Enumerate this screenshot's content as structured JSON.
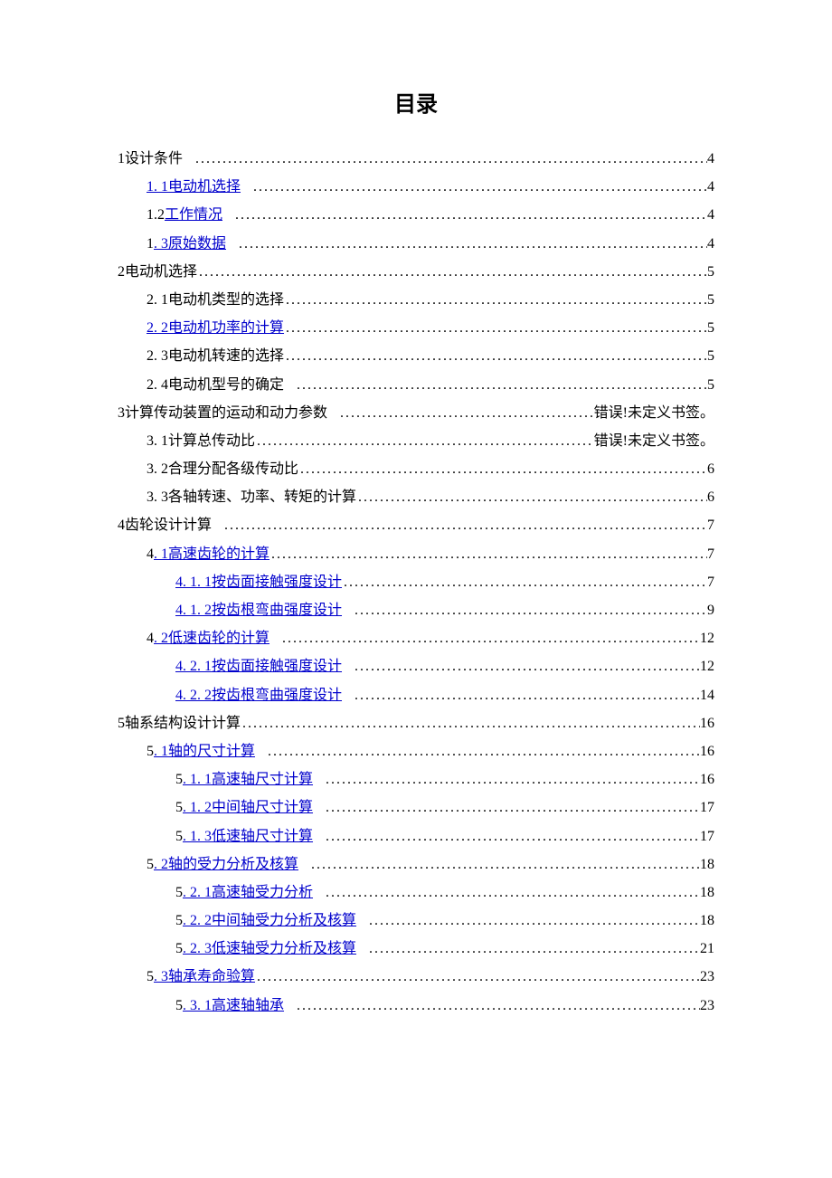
{
  "title": "目录",
  "entries": [
    {
      "level": 1,
      "label": "1设计条件",
      "page": "4",
      "linked": false,
      "leaderSpaced": true
    },
    {
      "level": 2,
      "prefix": "",
      "label": "1. 1电动机选择",
      "page": "4",
      "linked": true,
      "leaderSpaced": true
    },
    {
      "level": 2,
      "prefix": "1.2",
      "label": "工作情况",
      "page": "4",
      "linked": true,
      "leaderSpaced": true
    },
    {
      "level": 2,
      "prefix": "1",
      "label": ". 3原始数据",
      "page": "4",
      "linked": true,
      "leaderSpaced": true
    },
    {
      "level": 1,
      "label": "2电动机选择",
      "page": "5",
      "linked": false,
      "leaderSpaced": false
    },
    {
      "level": 2,
      "label": "2. 1电动机类型的选择",
      "page": "5",
      "linked": false,
      "leaderSpaced": false
    },
    {
      "level": 2,
      "prefix": "",
      "label": "2. 2电动机功率的计算",
      "page": "5",
      "linked": true,
      "leaderSpaced": false
    },
    {
      "level": 2,
      "label": "2. 3电动机转速的选择",
      "page": "5",
      "linked": false,
      "leaderSpaced": false
    },
    {
      "level": 2,
      "label": "2. 4电动机型号的确定",
      "page": "5",
      "linked": false,
      "leaderSpaced": true
    },
    {
      "level": 1,
      "label": "3计算传动装置的运动和动力参数",
      "page": "错误!未定义书签。",
      "linked": false,
      "leaderSpaced": true
    },
    {
      "level": 2,
      "label": "3. 1计算总传动比",
      "page": "错误!未定义书签。",
      "linked": false,
      "leaderSpaced": false
    },
    {
      "level": 2,
      "label": "3. 2合理分配各级传动比",
      "page": "6",
      "linked": false,
      "leaderSpaced": false
    },
    {
      "level": 2,
      "label": "3. 3各轴转速、功率、转矩的计算",
      "page": "6",
      "linked": false,
      "leaderSpaced": false
    },
    {
      "level": 1,
      "label": "4齿轮设计计算",
      "page": "7",
      "linked": false,
      "leaderSpaced": true
    },
    {
      "level": 2,
      "prefix": "4",
      "label": ". 1高速齿轮的计算",
      "page": "7",
      "linked": true,
      "leaderSpaced": false
    },
    {
      "level": 3,
      "prefix": "",
      "label": "4. 1. 1按齿面接触强度设计",
      "page": "7",
      "linked": true,
      "leaderSpaced": false
    },
    {
      "level": 3,
      "prefix": "",
      "label": "4. 1. 2按齿根弯曲强度设计",
      "page": "9",
      "linked": true,
      "leaderSpaced": true
    },
    {
      "level": 2,
      "prefix": "4",
      "label": ". 2低速齿轮的计算",
      "page": "12",
      "linked": true,
      "leaderSpaced": true
    },
    {
      "level": 3,
      "prefix": "",
      "label": "4. 2. 1按齿面接触强度设计",
      "page": "12",
      "linked": true,
      "leaderSpaced": true
    },
    {
      "level": 3,
      "prefix": "",
      "label": "4. 2. 2按齿根弯曲强度设计",
      "page": "14",
      "linked": true,
      "leaderSpaced": true
    },
    {
      "level": 1,
      "label": "5轴系结构设计计算",
      "page": "16",
      "linked": false,
      "leaderSpaced": false
    },
    {
      "level": 2,
      "prefix": "5",
      "label": ". 1轴的尺寸计算",
      "page": "16",
      "linked": true,
      "leaderSpaced": true
    },
    {
      "level": 3,
      "prefix": "5",
      "label": ". 1. 1高速轴尺寸计算",
      "page": "16",
      "linked": true,
      "leaderSpaced": true
    },
    {
      "level": 3,
      "prefix": "5",
      "label": ". 1. 2中间轴尺寸计算",
      "page": "17",
      "linked": true,
      "leaderSpaced": true
    },
    {
      "level": 3,
      "prefix": "5",
      "label": ". 1. 3低速轴尺寸计算",
      "page": "17",
      "linked": true,
      "leaderSpaced": true
    },
    {
      "level": 2,
      "prefix": "5",
      "label": ". 2轴的受力分析及核算",
      "page": "18",
      "linked": true,
      "leaderSpaced": true
    },
    {
      "level": 3,
      "prefix": "5",
      "label": ". 2. 1高速轴受力分析",
      "page": "18",
      "linked": true,
      "leaderSpaced": true
    },
    {
      "level": 3,
      "prefix": "5",
      "label": ". 2. 2中间轴受力分析及核算",
      "page": "18",
      "linked": true,
      "leaderSpaced": true
    },
    {
      "level": 3,
      "prefix": "5",
      "label": ". 2. 3低速轴受力分析及核算",
      "page": "21",
      "linked": true,
      "leaderSpaced": true
    },
    {
      "level": 2,
      "prefix": "5",
      "label": ". 3轴承寿命验算",
      "page": "23",
      "linked": true,
      "leaderSpaced": false
    },
    {
      "level": 3,
      "prefix": "5",
      "label": ". 3. 1高速轴轴承",
      "page": "23",
      "linked": true,
      "leaderSpaced": true
    }
  ]
}
